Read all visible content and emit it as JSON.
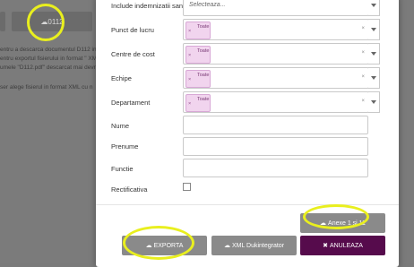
{
  "background": {
    "button_label": "0112",
    "text_lines": [
      "entru a descarca documentul D112 in",
      "entru exportul fisierului in format \" XM",
      "umele \"D112.pdf\" descarcat mai devre",
      "",
      "ser alege fisierul in format XML cu n"
    ]
  },
  "modal": {
    "fields": {
      "indemnizatii": {
        "label": "Include indemnizatii sanitari din",
        "placeholder": "Selecteaza..."
      },
      "punct_lucru": {
        "label": "Punct de lucru",
        "tag": "Toate"
      },
      "centre_cost": {
        "label": "Centre de cost",
        "tag": "Toate"
      },
      "echipe": {
        "label": "Echipe",
        "tag": "Toate"
      },
      "departament": {
        "label": "Departament",
        "tag": "Toate"
      },
      "nume": {
        "label": "Nume"
      },
      "prenume": {
        "label": "Prenume"
      },
      "functie": {
        "label": "Functie"
      },
      "rectificativa": {
        "label": "Rectificativa"
      }
    },
    "buttons": {
      "anexe": "Anexe 1 si 11",
      "exporta": "EXPORTA",
      "xml": "XML Dukintegrator",
      "anuleaza": "ANULEAZA"
    }
  },
  "colors": {
    "accent_purple": "#560b4c",
    "tag_bg": "#f1d4ee",
    "highlight": "#e9ef1e"
  }
}
